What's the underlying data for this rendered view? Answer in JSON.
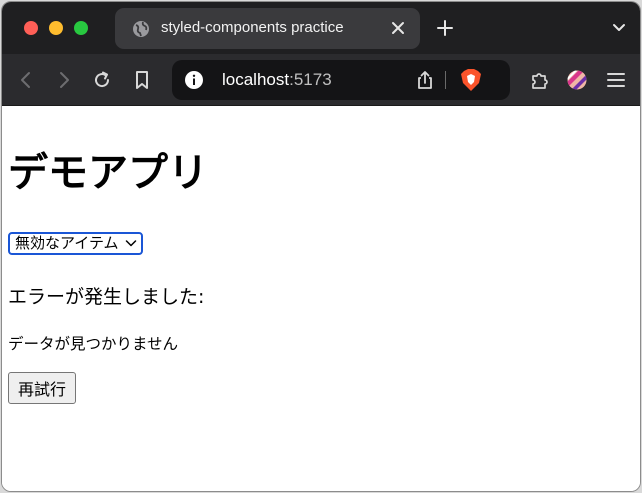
{
  "browser": {
    "tab": {
      "title": "styled-components practice"
    },
    "address_bar": {
      "host": "localhost",
      "port": ":5173"
    },
    "colors": {
      "tabstrip": "#1f1f21",
      "toolbar": "#2b2b2e",
      "brave_orange": "#fb542b"
    }
  },
  "page": {
    "title": "デモアプリ",
    "select": {
      "selected": "無効なアイテム"
    },
    "error": {
      "heading": "エラーが発生しました:",
      "message": "データが見つかりません"
    },
    "retry_label": "再試行"
  }
}
